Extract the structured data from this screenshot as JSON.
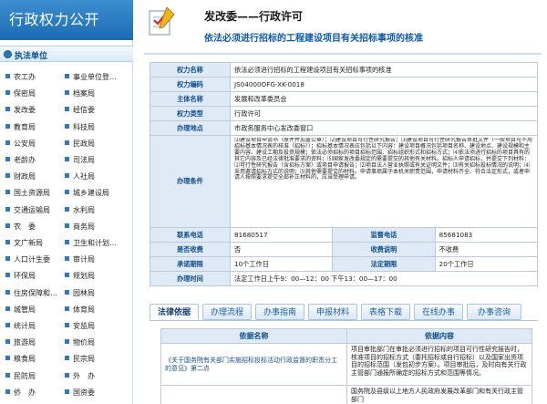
{
  "banner": {
    "title": "行政权力公开"
  },
  "section": {
    "title": "执法单位"
  },
  "departments": [
    "农工办",
    "事业单位登…",
    "保密局",
    "档案局",
    "发改委",
    "经信委",
    "教育局",
    "科技局",
    "公安局",
    "民政局",
    "老龄办",
    "司法局",
    "财政局",
    "人社局",
    "国土资源局",
    "城乡建设局",
    "交通运输局",
    "水利局",
    "农　委",
    "商务局",
    "文广新局",
    "卫生和计划…",
    "人口计生委",
    "审计局",
    "环保局",
    "规划局",
    "住房保障和…",
    "园林局",
    "城管局",
    "体育局",
    "统计局",
    "安监局",
    "旅游局",
    "物价局",
    "粮食局",
    "民宗局",
    "民防局",
    "外　办",
    "侨　办",
    "国资委"
  ],
  "header": {
    "title": "发改委——行政许可",
    "subtitle": "依法必须进行招标的工程建设项目有关招标事项的核准"
  },
  "info": {
    "name_label": "权力名称",
    "name_value": "依法必须进行招标的工程建设项目有关招标事项的核准",
    "code_label": "权力编码",
    "code_value": "JS04000OFG-XK-0018",
    "dept_label": "主体名称",
    "dept_value": "发展和改革委员会",
    "type_label": "权力类型",
    "type_value": "行政许可",
    "place_label": "办理地点",
    "place_value": "市政务服务中心发改委窗口",
    "cond_label": "办理条件",
    "cond_value": "⑴建设项目申请书（原件并加盖公章）；⑵建设项目可行性研究报告；⑶建设项目可行性研究报告审批文件（一般项目可不用招标基本情况表的核准（招标））；招标基本情况表应包括以下内容：建设项目概况包括项目名称、建设地点、建设规模和主要内容、建设工期及投资规模；依法必须招标的项目招标范围、招标组织形式和招标方式；⑷依法须进行招标的项目具有的其它内容及已经法律批准要求的资料；⑸国家发改委规定的需要提交的其他有关材料。招标人申请招标，并提交下列材料：⑴可行性研究报告（含招标方案）或项目申请报告；⑵项目法人营业执照或有关证明文件；⑶有关招标投标情况的说明；⑷采用邀请招标方式的说明；⑸其他需要提交的材料。申请事项属于本机关职责范围，申请材料齐全、符合法定形式，或者申请人按照要求提交全部补正材料的，应当受理申请。",
    "phone_label": "联系电话",
    "phone_value": "81680517",
    "sup_label": "监督电话",
    "sup_value": "85681083",
    "fee_label": "是否收费",
    "fee_value": "否",
    "fee_note_label": "收费说明",
    "fee_note_value": "不收费",
    "promise_label": "承诺期限",
    "promise_value": "10个工作日",
    "legal_label": "法定期限",
    "legal_value": "20个工作日",
    "time_label": "办理时间",
    "time_value": "法定工作日上午9：00—12：00 下午13：00—17：00"
  },
  "tabs": [
    "法律依据",
    "办理流程",
    "办事指南",
    "申报材料",
    "表格下载",
    "在线办事",
    "办事咨询"
  ],
  "basis": {
    "col1": "依据名称",
    "col2": "依据内容",
    "row1_name": "《关于国务院有关部门实施招标投标活动行政监督的职责分工的意见》第二点",
    "row1_content": "项目审批部门在审批必须进行招标的项目可行性研究报告时，核准项目的招标方式（委托招标或自行招标）以及国家出资项目的招标范围（发包初步方案）。项目审批后，及时向有关行政主管部门通报所确定的招标方式和范围等情况。",
    "row2_content": "国务院及县级以上地方人民政府发展改革部门和有关行政主管部门"
  },
  "colors": {
    "accent": "#1c6bb3",
    "label_bg": "#dfeaf6",
    "border": "#b8cce0"
  }
}
